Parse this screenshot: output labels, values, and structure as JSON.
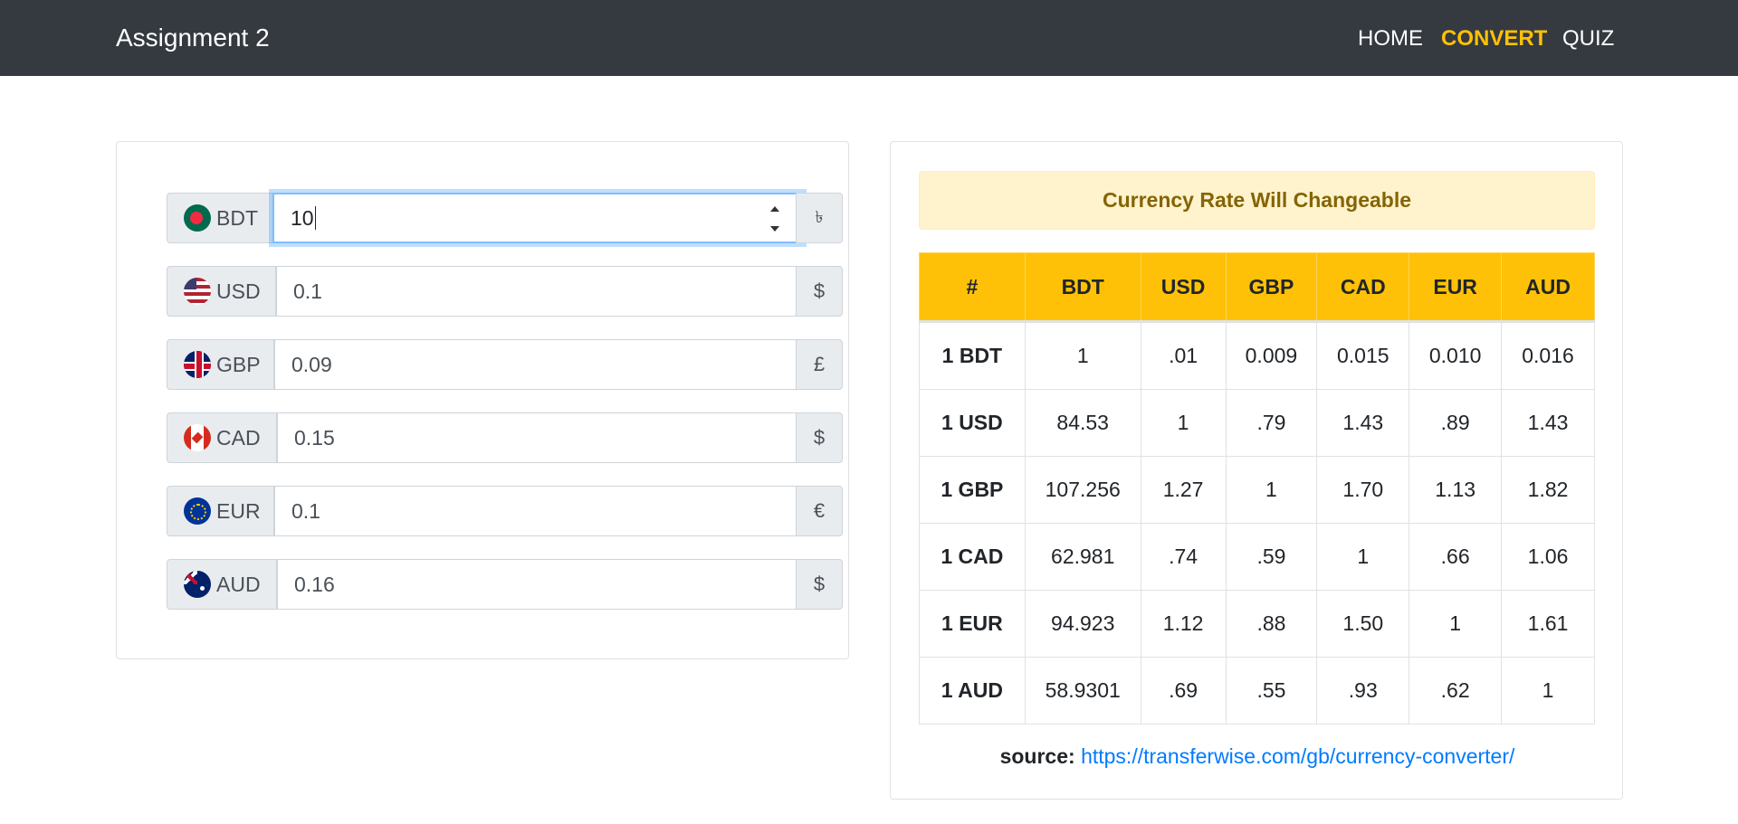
{
  "nav": {
    "brand": "Assignment 2",
    "links": [
      {
        "label": "HOME",
        "active": false
      },
      {
        "label": "CONVERT",
        "active": true
      },
      {
        "label": "QUIZ",
        "active": false
      }
    ]
  },
  "converter": {
    "rows": [
      {
        "code": "BDT",
        "flag_icon": "bangladesh-flag-icon",
        "value": "10",
        "symbol": "৳",
        "focused": true
      },
      {
        "code": "USD",
        "flag_icon": "usa-flag-icon",
        "value": "0.1",
        "symbol": "$"
      },
      {
        "code": "GBP",
        "flag_icon": "uk-flag-icon",
        "value": "0.09",
        "symbol": "£"
      },
      {
        "code": "CAD",
        "flag_icon": "canada-flag-icon",
        "value": "0.15",
        "symbol": "$"
      },
      {
        "code": "EUR",
        "flag_icon": "eu-flag-icon",
        "value": "0.1",
        "symbol": "€"
      },
      {
        "code": "AUD",
        "flag_icon": "australia-flag-icon",
        "value": "0.16",
        "symbol": "$"
      }
    ]
  },
  "rates": {
    "alert": "Currency Rate Will Changeable",
    "headers": [
      "#",
      "BDT",
      "USD",
      "GBP",
      "CAD",
      "EUR",
      "AUD"
    ],
    "rows": [
      [
        "1 BDT",
        "1",
        ".01",
        "0.009",
        "0.015",
        "0.010",
        "0.016"
      ],
      [
        "1 USD",
        "84.53",
        "1",
        ".79",
        "1.43",
        ".89",
        "1.43"
      ],
      [
        "1 GBP",
        "107.256",
        "1.27",
        "1",
        "1.70",
        "1.13",
        "1.82"
      ],
      [
        "1 CAD",
        "62.981",
        ".74",
        ".59",
        "1",
        ".66",
        "1.06"
      ],
      [
        "1 EUR",
        "94.923",
        "1.12",
        ".88",
        "1.50",
        "1",
        "1.61"
      ],
      [
        "1 AUD",
        "58.9301",
        ".69",
        ".55",
        ".93",
        ".62",
        "1"
      ]
    ],
    "source_label": "source:",
    "source_url": "https://transferwise.com/gb/currency-converter/"
  },
  "colors": {
    "navbar": "#343a40",
    "accent": "#ffc107",
    "link": "#007bff",
    "alert_bg": "#fff3cd",
    "alert_text": "#856404"
  }
}
